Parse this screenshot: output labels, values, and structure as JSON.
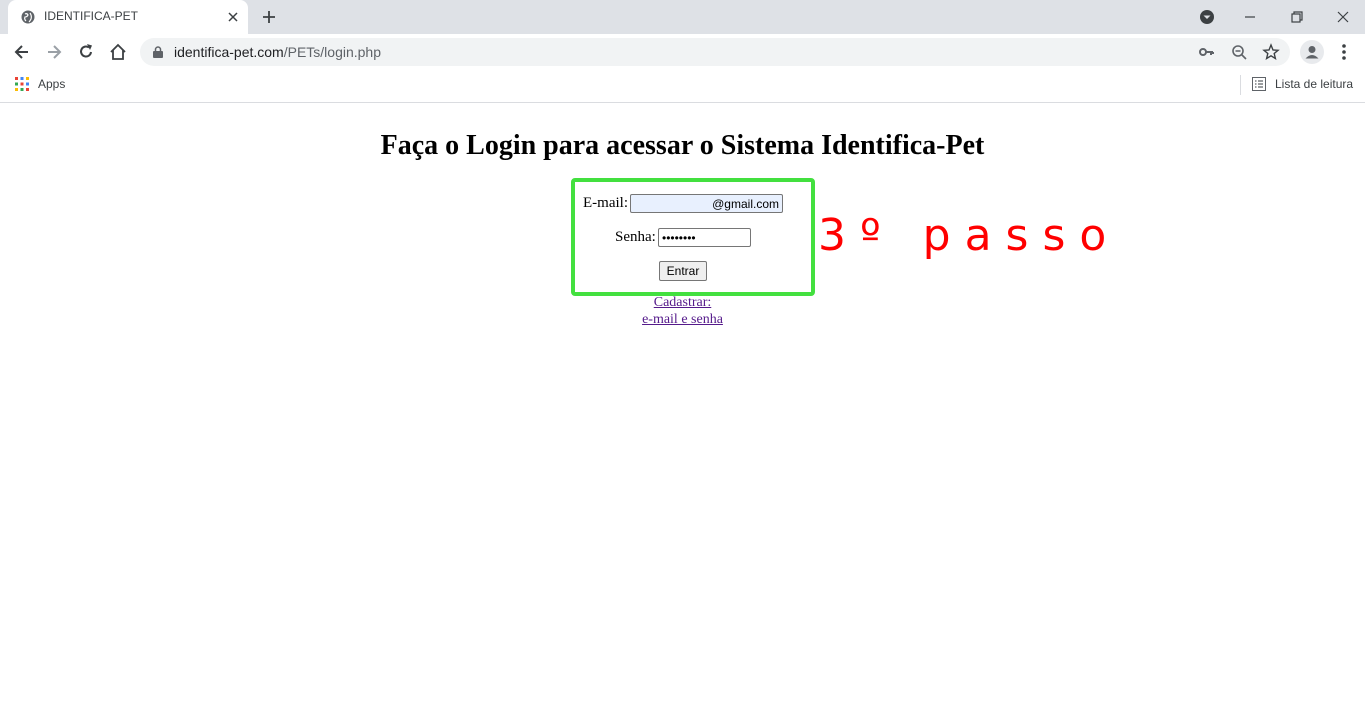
{
  "browser": {
    "tab_title": "IDENTIFICA-PET",
    "url_domain": "identifica-pet.com",
    "url_path": "/PETs/login.php",
    "bookmarks": {
      "apps_label": "Apps",
      "reading_list_label": "Lista de leitura"
    }
  },
  "page": {
    "title": "Faça o Login para acessar o Sistema Identifica-Pet",
    "form": {
      "email_label": "E-mail:",
      "email_value": "@gmail.com",
      "password_label": "Senha:",
      "password_value": "12345678",
      "submit_label": "Entrar"
    },
    "register_link_line1": "Cadastrar:",
    "register_link_line2": "e-mail e senha",
    "annotation": "3 º   p a s s o"
  },
  "colors": {
    "highlight": "#43e03f",
    "annotation": "#ff0000",
    "link": "#551a8b"
  }
}
